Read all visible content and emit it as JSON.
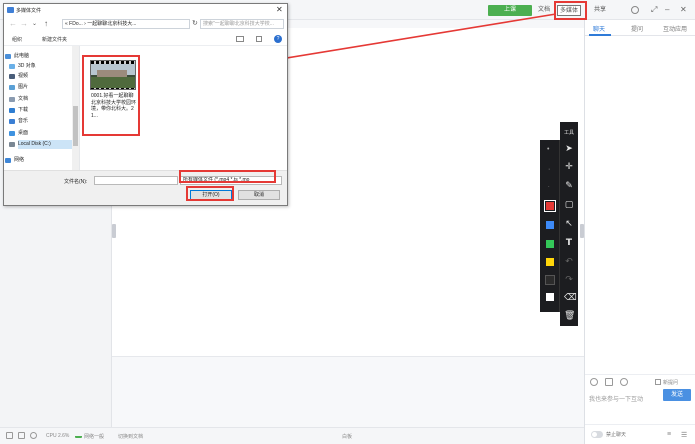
{
  "topbar": {
    "green_button": "上课",
    "doc_label": "文档",
    "media_label": "多媒体",
    "share_label": "共享"
  },
  "right_panel": {
    "tabs": [
      "聊天",
      "提问",
      "互动应用"
    ],
    "input_placeholder": "我也来参与一下互动",
    "send_label": "发送",
    "private_chat_label": "新提问",
    "mute_label": "禁止聊天"
  },
  "statusbar": {
    "cpu": "CPU 2.6%",
    "network": "网络一般",
    "switch_doc": "切换到文档",
    "whiteboard": "白板"
  },
  "toolbar": {
    "label": "工具",
    "tools": [
      "select-pointer",
      "laser",
      "pen",
      "rectangle",
      "line",
      "text",
      "undo",
      "redo",
      "eraser",
      "delete"
    ],
    "colors": [
      "#e53935",
      "#3d8af7",
      "#34c759",
      "#ffd60a",
      "#2b2b2b",
      "#ffffff"
    ],
    "selected_color": "#e53935"
  },
  "dialog": {
    "title": "多媒体文件",
    "address": "« FDo... › 一起聊聊北京科技大...",
    "search_placeholder": "搜索\"一起聊聊北京科技大学校...",
    "organize": "组织",
    "new_folder": "新建文件夹",
    "sidebar": [
      {
        "label": "此电脑",
        "icon": "computer-icon"
      },
      {
        "label": "3D 对象",
        "icon": "cube-icon"
      },
      {
        "label": "视频",
        "icon": "video-folder-icon"
      },
      {
        "label": "图片",
        "icon": "pictures-folder-icon"
      },
      {
        "label": "文档",
        "icon": "documents-folder-icon"
      },
      {
        "label": "下载",
        "icon": "downloads-folder-icon"
      },
      {
        "label": "音乐",
        "icon": "music-folder-icon"
      },
      {
        "label": "桌面",
        "icon": "desktop-folder-icon"
      },
      {
        "label": "Local Disk (C:)",
        "icon": "drive-icon"
      },
      {
        "label": "网络",
        "icon": "network-icon"
      }
    ],
    "file": {
      "name": "0001.好看一起聊聊北京科技大学校园环境，带你北科大。21..."
    },
    "filename_label": "文件名(N):",
    "filename_value": "",
    "filetype": "所有媒体文件 (*.mp4 *.ts *.mo",
    "open_label": "打开(O)",
    "cancel_label": "取消"
  }
}
